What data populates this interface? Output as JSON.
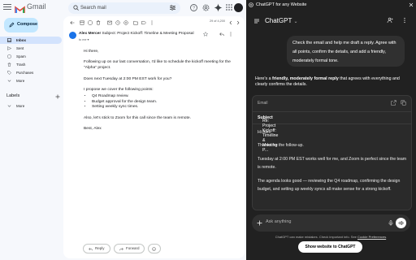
{
  "gmail": {
    "logo_text": "Gmail",
    "search": {
      "placeholder": "Search mail"
    },
    "compose_label": "Compose",
    "nav": [
      {
        "label": "Inbox",
        "icon": "inbox-icon",
        "active": true
      },
      {
        "label": "Sent",
        "icon": "send-icon"
      },
      {
        "label": "Spam",
        "icon": "spam-icon"
      },
      {
        "label": "Trash",
        "icon": "trash-icon"
      },
      {
        "label": "Purchases",
        "icon": "tag-icon"
      },
      {
        "label": "More",
        "icon": "chevron-down-icon"
      }
    ],
    "labels_heading": "Labels",
    "labels_more": "More",
    "pager": "29 of 4,200",
    "message": {
      "sender_name": "Alex Mercer",
      "subject": "Subject: Project Kickoff: Timeline & Meeting Proposal",
      "to": "to me",
      "greeting": "Hi there,",
      "p1": "Following up on our last conversation, I'd like to schedule the kickoff meeting for the \"Alpha\" project.",
      "p2": "Does next Tuesday at 2:00 PM EST work for you?",
      "p3": "I propose we cover the following points:",
      "bullets": [
        "Q4 Roadmap review.",
        "Budget approval for the design team.",
        "Setting weekly sync times."
      ],
      "p4": "Also, let's stick to Zoom for this call since the team is remote.",
      "signoff": "Best, Alex"
    },
    "reply_label": "Reply",
    "forward_label": "Forward"
  },
  "chatgpt": {
    "window_title": "ChatGPT for any Website",
    "model_label": "ChatGPT",
    "user_message": "Check the email and help me draft a reply. Agree with all points, confirm the details, and add a friendly, moderately formal tone.",
    "assistant_intro_pre": "Here's a ",
    "assistant_intro_bold": "friendly, moderately formal reply",
    "assistant_intro_post": " that agrees with everything and clearly confirms the details.",
    "email_card": {
      "header": "Email",
      "subject_label": "Subject",
      "subject_value": "Re: Project Kickoff: Timeline & Meeting P...",
      "lines": [
        "Hi Alex,",
        "Thanks for the follow-up.",
        "Tuesday at 2:00 PM EST works well for me, and Zoom is perfect since the team is remote.",
        "The agenda looks good — reviewing the Q4 roadmap, confirming the design budget, and setting up weekly syncs all make sense for a strong kickoff."
      ]
    },
    "ask_placeholder": "Ask anything",
    "disclaimer": "ChatGPT can make mistakes. Check important info. See ",
    "disclaimer_link": "Cookie Preferences",
    "show_button": "Show website to ChatGPT"
  },
  "colors": {
    "gmail_bg": "#f6f8fc",
    "compose_bg": "#c2e7ff",
    "active_nav": "#d3e3fd",
    "gpt_bg": "#212121",
    "gpt_bubble": "#303030"
  }
}
